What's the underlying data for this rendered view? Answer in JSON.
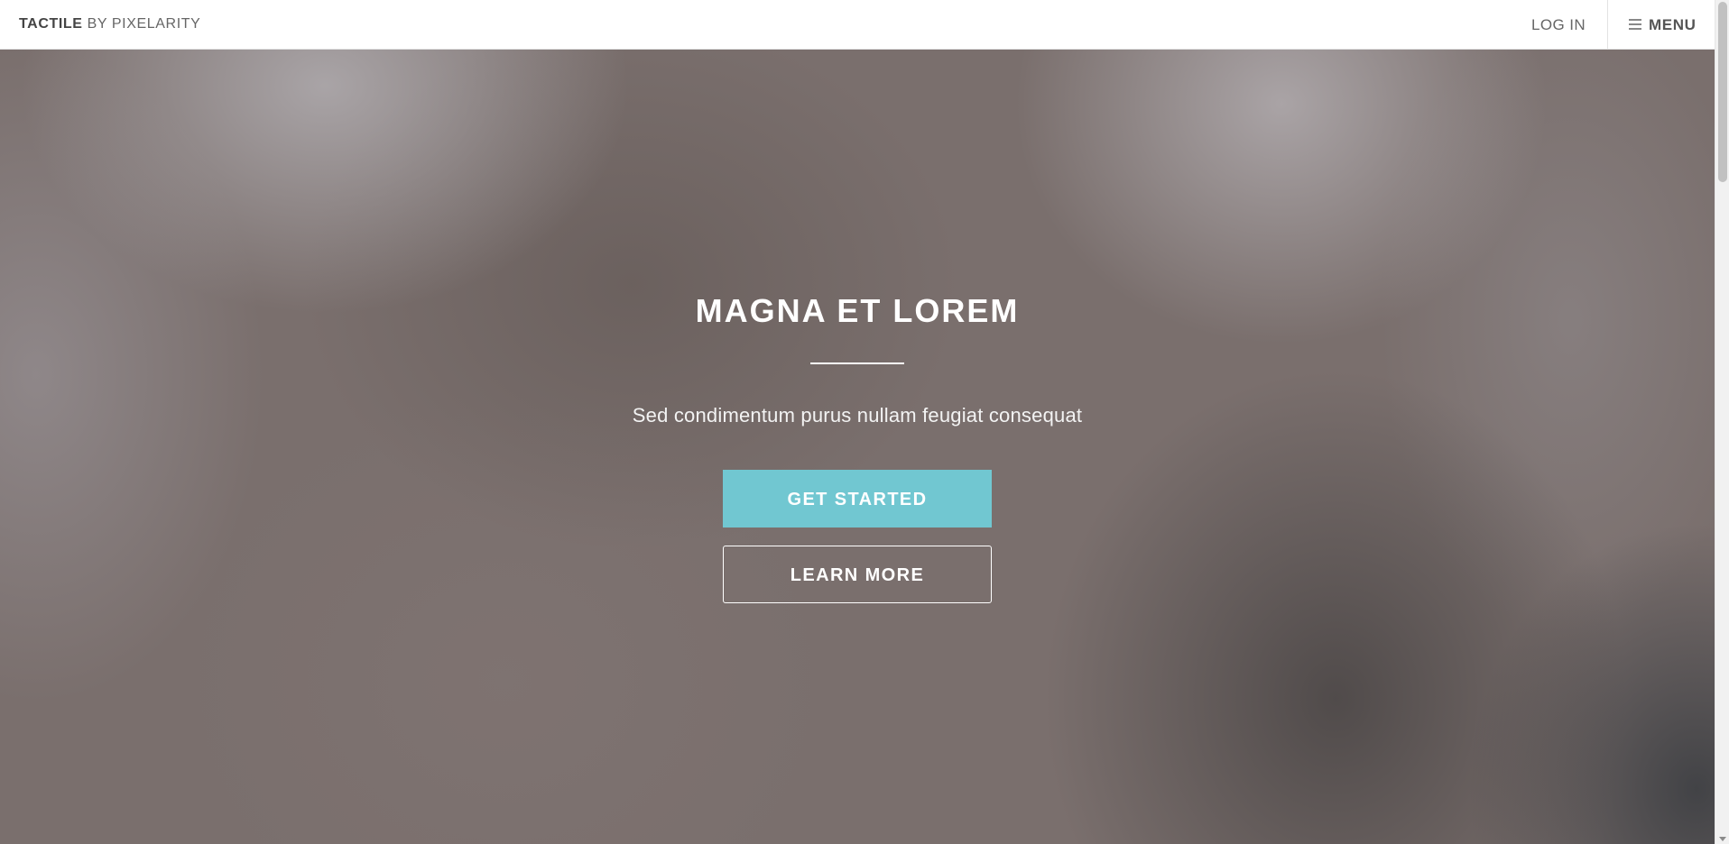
{
  "header": {
    "brand": "TACTILE",
    "brand_suffix": "BY PIXELARITY",
    "login_label": "LOG IN",
    "menu_label": "MENU"
  },
  "hero": {
    "title": "MAGNA ET LOREM",
    "subtitle": "Sed condimentum purus nullam feugiat consequat",
    "primary_button_label": "GET STARTED",
    "secondary_button_label": "LEARN MORE"
  },
  "colors": {
    "accent": "#71c7d1",
    "header_background": "#ffffff",
    "hero_text": "#ffffff"
  },
  "icons": {
    "menu": "hamburger-icon"
  }
}
